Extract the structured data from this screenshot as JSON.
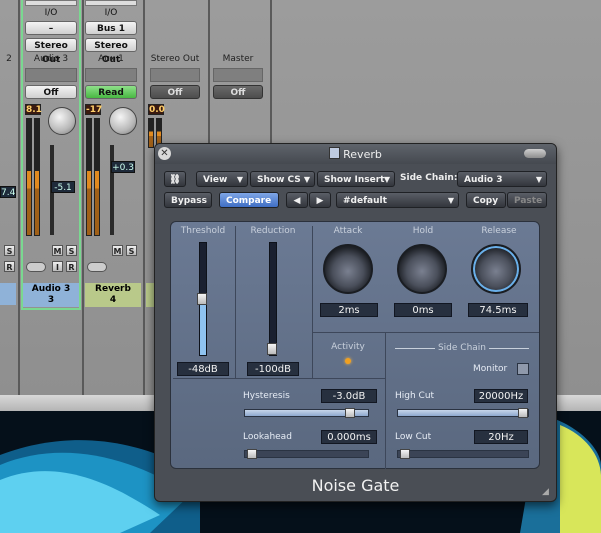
{
  "mixer": {
    "partial_strip": {
      "label": "2",
      "volume": "7.4"
    },
    "strips": [
      {
        "io_label": "I/O",
        "input": "–",
        "output": "Stereo Out",
        "name": "Audio 3",
        "automation": "Off",
        "peak": "8.1",
        "volume": "-5.1",
        "tile_line1": "Audio 3",
        "tile_line2": "3",
        "tile_color": "#8fb2d8"
      },
      {
        "io_label": "I/O",
        "input": "Bus 1",
        "output": "Stereo Out",
        "name": "Aux 1",
        "automation": "Read",
        "peak": "-17",
        "volume": "+0.3",
        "tile_line1": "Reverb",
        "tile_line2": "4",
        "tile_color": "#b9c98a"
      },
      {
        "name": "Stereo Out",
        "automation": "Off",
        "peak": "0.0"
      },
      {
        "name": "Master",
        "automation": "Off"
      }
    ],
    "ms_buttons": {
      "mute": "M",
      "solo": "S",
      "input": "I",
      "record": "R"
    }
  },
  "plugin": {
    "title": "Reverb",
    "toolbar": {
      "view": "View",
      "show_cs": "Show CS",
      "show_insert": "Show Insert",
      "side_chain_label": "Side Chain:",
      "side_chain_value": "Audio 3",
      "bypass": "Bypass",
      "compare": "Compare",
      "prev": "◀",
      "next": "▶",
      "preset": "#default",
      "copy": "Copy",
      "paste": "Paste"
    },
    "threshold": {
      "label": "Threshold",
      "value": "-48dB"
    },
    "reduction": {
      "label": "Reduction",
      "value": "-100dB"
    },
    "attack": {
      "label": "Attack",
      "value": "2ms"
    },
    "hold": {
      "label": "Hold",
      "value": "0ms"
    },
    "release": {
      "label": "Release",
      "value": "74.5ms"
    },
    "activity": {
      "label": "Activity"
    },
    "side_chain": {
      "title": "Side Chain",
      "monitor": "Monitor",
      "high_cut": {
        "label": "High Cut",
        "value": "20000Hz"
      },
      "low_cut": {
        "label": "Low Cut",
        "value": "20Hz"
      }
    },
    "hysteresis": {
      "label": "Hysteresis",
      "value": "-3.0dB"
    },
    "lookahead": {
      "label": "Lookahead",
      "value": "0.000ms"
    },
    "name": "Noise Gate"
  }
}
